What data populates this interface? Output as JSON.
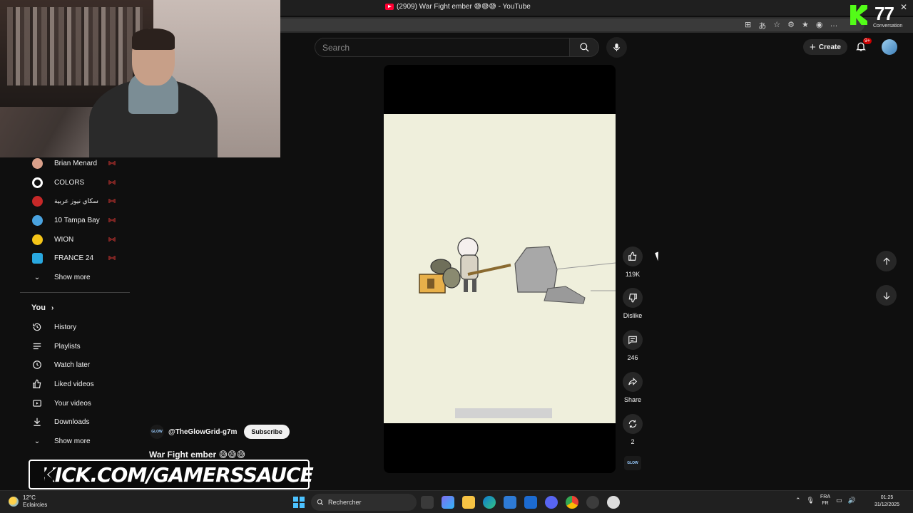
{
  "window": {
    "tab_title": "(2909) War Fight ember 😅😅😅 - YouTube"
  },
  "search": {
    "placeholder": "Search"
  },
  "header": {
    "create_label": "Create",
    "notifications_badge": "9+"
  },
  "kick_overlay": {
    "viewer_count": "77",
    "viewer_label": "Conversation",
    "banner_text": "KICK.COM/GAMERSSAUCE"
  },
  "sidebar": {
    "subscriptions": [
      {
        "label": "Brian Menard",
        "icon": "avatar-icon",
        "color": "#d9a08a"
      },
      {
        "label": "COLORS",
        "icon": "colors-logo-icon",
        "color": "#ffffff"
      },
      {
        "label": "سكاي نيوز عربية",
        "icon": "sky-news-logo-icon",
        "color": "#c62828"
      },
      {
        "label": "10 Tampa Bay",
        "icon": "tampa-bay-logo-icon",
        "color": "#4aa3df"
      },
      {
        "label": "WION",
        "icon": "wion-logo-icon",
        "color": "#f5c518"
      },
      {
        "label": "FRANCE 24",
        "icon": "france24-logo-icon",
        "color": "#29a8e0"
      }
    ],
    "show_more_1": "Show more",
    "you_heading": "You",
    "you_items": [
      {
        "label": "History",
        "icon": "history-icon"
      },
      {
        "label": "Playlists",
        "icon": "playlists-icon"
      },
      {
        "label": "Watch later",
        "icon": "watch-later-icon"
      },
      {
        "label": "Liked videos",
        "icon": "thumb-up-icon"
      },
      {
        "label": "Your videos",
        "icon": "your-videos-icon"
      },
      {
        "label": "Downloads",
        "icon": "download-icon"
      }
    ],
    "show_more_2": "Show more"
  },
  "video": {
    "channel_handle": "@TheGlowGrid-g7m",
    "channel_logo_text": "GLOW",
    "subscribe_label": "Subscribe",
    "title": "War Fight ember 😅😅😅"
  },
  "actions": {
    "like_count": "119K",
    "dislike_label": "Dislike",
    "comment_count": "246",
    "share_label": "Share",
    "remix_count": "2"
  },
  "taskbar": {
    "weather_temp": "12°C",
    "weather_desc": "Eclaircies",
    "search_label": "Rechercher",
    "lang_top": "FRA",
    "lang_bottom": "FR",
    "time": "01:25",
    "date": "31/12/2025"
  },
  "colors": {
    "yt_red": "#ff0033",
    "kick_green": "#53fc18",
    "live_red": "#e53935"
  }
}
